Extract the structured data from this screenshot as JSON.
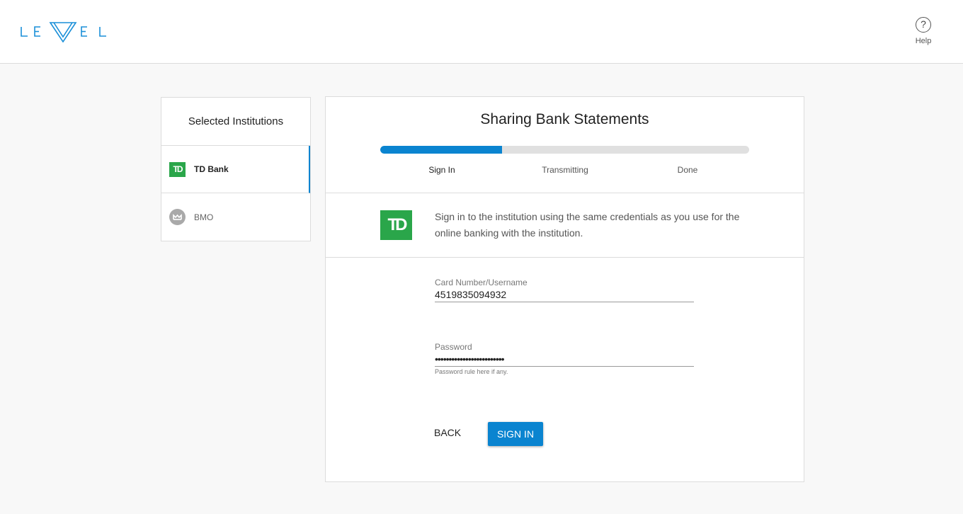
{
  "header": {
    "logo_text": "LEVEL",
    "help_icon": "question-icon",
    "help_label": "Help"
  },
  "sidebar": {
    "title": "Selected Institutions",
    "items": [
      {
        "label": "TD Bank",
        "icon": "td-bank-logo",
        "logo_text": "TD",
        "active": true
      },
      {
        "label": "BMO",
        "icon": "bmo-logo",
        "active": false
      }
    ]
  },
  "main": {
    "title": "Sharing Bank Statements",
    "progress_fraction": 0.33,
    "steps": [
      "Sign In",
      "Transmitting",
      "Done"
    ],
    "current_step": "Sign In",
    "bank_logo_text": "TD",
    "instructions": "Sign in to the institution using the same credentials as you use for the online banking with the institution.",
    "form": {
      "username_label": "Card Number/Username",
      "username_value": "4519835094932",
      "password_label": "Password",
      "password_value": "•••••••••••••••••••••••••",
      "password_hint": "Password rule here if any."
    },
    "buttons": {
      "back": "BACK",
      "sign_in": "SIGN IN"
    }
  },
  "colors": {
    "accent": "#0a84d0",
    "td_green": "#2aa64a",
    "progress_track": "#e0e0e0"
  }
}
